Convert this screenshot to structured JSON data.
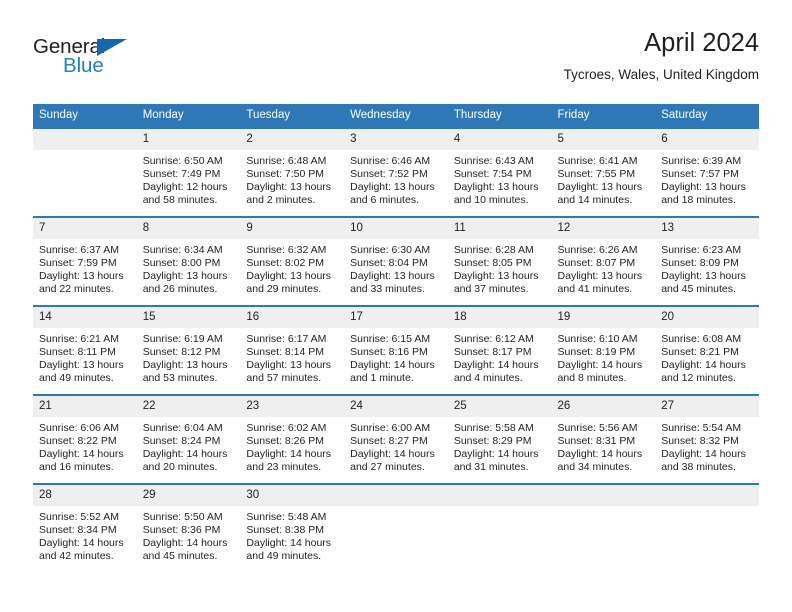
{
  "logo": {
    "word1": "General",
    "word2": "Blue",
    "triangle_color": "#1567b0",
    "word2_color": "#1f7fd0",
    "icon": "general-blue-logo"
  },
  "header": {
    "title": "April 2024",
    "subtitle": "Tycroes, Wales, United Kingdom"
  },
  "theme": {
    "header_bar": "#2f78b8",
    "daynum_strip": "#efefef",
    "text": "#231f20",
    "week_divider": "#2f78b8"
  },
  "weekdays": [
    "Sunday",
    "Monday",
    "Tuesday",
    "Wednesday",
    "Thursday",
    "Friday",
    "Saturday"
  ],
  "weeks": [
    [
      {
        "day": "",
        "sunrise": "",
        "sunset": "",
        "daylight1": "",
        "daylight2": ""
      },
      {
        "day": "1",
        "sunrise": "Sunrise: 6:50 AM",
        "sunset": "Sunset: 7:49 PM",
        "daylight1": "Daylight: 12 hours",
        "daylight2": "and 58 minutes."
      },
      {
        "day": "2",
        "sunrise": "Sunrise: 6:48 AM",
        "sunset": "Sunset: 7:50 PM",
        "daylight1": "Daylight: 13 hours",
        "daylight2": "and 2 minutes."
      },
      {
        "day": "3",
        "sunrise": "Sunrise: 6:46 AM",
        "sunset": "Sunset: 7:52 PM",
        "daylight1": "Daylight: 13 hours",
        "daylight2": "and 6 minutes."
      },
      {
        "day": "4",
        "sunrise": "Sunrise: 6:43 AM",
        "sunset": "Sunset: 7:54 PM",
        "daylight1": "Daylight: 13 hours",
        "daylight2": "and 10 minutes."
      },
      {
        "day": "5",
        "sunrise": "Sunrise: 6:41 AM",
        "sunset": "Sunset: 7:55 PM",
        "daylight1": "Daylight: 13 hours",
        "daylight2": "and 14 minutes."
      },
      {
        "day": "6",
        "sunrise": "Sunrise: 6:39 AM",
        "sunset": "Sunset: 7:57 PM",
        "daylight1": "Daylight: 13 hours",
        "daylight2": "and 18 minutes."
      }
    ],
    [
      {
        "day": "7",
        "sunrise": "Sunrise: 6:37 AM",
        "sunset": "Sunset: 7:59 PM",
        "daylight1": "Daylight: 13 hours",
        "daylight2": "and 22 minutes."
      },
      {
        "day": "8",
        "sunrise": "Sunrise: 6:34 AM",
        "sunset": "Sunset: 8:00 PM",
        "daylight1": "Daylight: 13 hours",
        "daylight2": "and 26 minutes."
      },
      {
        "day": "9",
        "sunrise": "Sunrise: 6:32 AM",
        "sunset": "Sunset: 8:02 PM",
        "daylight1": "Daylight: 13 hours",
        "daylight2": "and 29 minutes."
      },
      {
        "day": "10",
        "sunrise": "Sunrise: 6:30 AM",
        "sunset": "Sunset: 8:04 PM",
        "daylight1": "Daylight: 13 hours",
        "daylight2": "and 33 minutes."
      },
      {
        "day": "11",
        "sunrise": "Sunrise: 6:28 AM",
        "sunset": "Sunset: 8:05 PM",
        "daylight1": "Daylight: 13 hours",
        "daylight2": "and 37 minutes."
      },
      {
        "day": "12",
        "sunrise": "Sunrise: 6:26 AM",
        "sunset": "Sunset: 8:07 PM",
        "daylight1": "Daylight: 13 hours",
        "daylight2": "and 41 minutes."
      },
      {
        "day": "13",
        "sunrise": "Sunrise: 6:23 AM",
        "sunset": "Sunset: 8:09 PM",
        "daylight1": "Daylight: 13 hours",
        "daylight2": "and 45 minutes."
      }
    ],
    [
      {
        "day": "14",
        "sunrise": "Sunrise: 6:21 AM",
        "sunset": "Sunset: 8:11 PM",
        "daylight1": "Daylight: 13 hours",
        "daylight2": "and 49 minutes."
      },
      {
        "day": "15",
        "sunrise": "Sunrise: 6:19 AM",
        "sunset": "Sunset: 8:12 PM",
        "daylight1": "Daylight: 13 hours",
        "daylight2": "and 53 minutes."
      },
      {
        "day": "16",
        "sunrise": "Sunrise: 6:17 AM",
        "sunset": "Sunset: 8:14 PM",
        "daylight1": "Daylight: 13 hours",
        "daylight2": "and 57 minutes."
      },
      {
        "day": "17",
        "sunrise": "Sunrise: 6:15 AM",
        "sunset": "Sunset: 8:16 PM",
        "daylight1": "Daylight: 14 hours",
        "daylight2": "and 1 minute."
      },
      {
        "day": "18",
        "sunrise": "Sunrise: 6:12 AM",
        "sunset": "Sunset: 8:17 PM",
        "daylight1": "Daylight: 14 hours",
        "daylight2": "and 4 minutes."
      },
      {
        "day": "19",
        "sunrise": "Sunrise: 6:10 AM",
        "sunset": "Sunset: 8:19 PM",
        "daylight1": "Daylight: 14 hours",
        "daylight2": "and 8 minutes."
      },
      {
        "day": "20",
        "sunrise": "Sunrise: 6:08 AM",
        "sunset": "Sunset: 8:21 PM",
        "daylight1": "Daylight: 14 hours",
        "daylight2": "and 12 minutes."
      }
    ],
    [
      {
        "day": "21",
        "sunrise": "Sunrise: 6:06 AM",
        "sunset": "Sunset: 8:22 PM",
        "daylight1": "Daylight: 14 hours",
        "daylight2": "and 16 minutes."
      },
      {
        "day": "22",
        "sunrise": "Sunrise: 6:04 AM",
        "sunset": "Sunset: 8:24 PM",
        "daylight1": "Daylight: 14 hours",
        "daylight2": "and 20 minutes."
      },
      {
        "day": "23",
        "sunrise": "Sunrise: 6:02 AM",
        "sunset": "Sunset: 8:26 PM",
        "daylight1": "Daylight: 14 hours",
        "daylight2": "and 23 minutes."
      },
      {
        "day": "24",
        "sunrise": "Sunrise: 6:00 AM",
        "sunset": "Sunset: 8:27 PM",
        "daylight1": "Daylight: 14 hours",
        "daylight2": "and 27 minutes."
      },
      {
        "day": "25",
        "sunrise": "Sunrise: 5:58 AM",
        "sunset": "Sunset: 8:29 PM",
        "daylight1": "Daylight: 14 hours",
        "daylight2": "and 31 minutes."
      },
      {
        "day": "26",
        "sunrise": "Sunrise: 5:56 AM",
        "sunset": "Sunset: 8:31 PM",
        "daylight1": "Daylight: 14 hours",
        "daylight2": "and 34 minutes."
      },
      {
        "day": "27",
        "sunrise": "Sunrise: 5:54 AM",
        "sunset": "Sunset: 8:32 PM",
        "daylight1": "Daylight: 14 hours",
        "daylight2": "and 38 minutes."
      }
    ],
    [
      {
        "day": "28",
        "sunrise": "Sunrise: 5:52 AM",
        "sunset": "Sunset: 8:34 PM",
        "daylight1": "Daylight: 14 hours",
        "daylight2": "and 42 minutes."
      },
      {
        "day": "29",
        "sunrise": "Sunrise: 5:50 AM",
        "sunset": "Sunset: 8:36 PM",
        "daylight1": "Daylight: 14 hours",
        "daylight2": "and 45 minutes."
      },
      {
        "day": "30",
        "sunrise": "Sunrise: 5:48 AM",
        "sunset": "Sunset: 8:38 PM",
        "daylight1": "Daylight: 14 hours",
        "daylight2": "and 49 minutes."
      },
      {
        "day": "",
        "sunrise": "",
        "sunset": "",
        "daylight1": "",
        "daylight2": ""
      },
      {
        "day": "",
        "sunrise": "",
        "sunset": "",
        "daylight1": "",
        "daylight2": ""
      },
      {
        "day": "",
        "sunrise": "",
        "sunset": "",
        "daylight1": "",
        "daylight2": ""
      },
      {
        "day": "",
        "sunrise": "",
        "sunset": "",
        "daylight1": "",
        "daylight2": ""
      }
    ]
  ]
}
